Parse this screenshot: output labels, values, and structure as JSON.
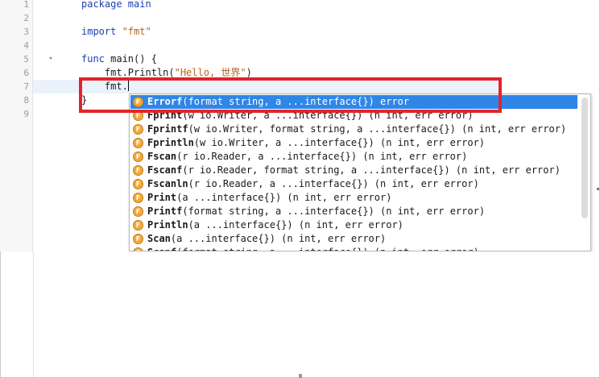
{
  "editor": {
    "lines": [
      {
        "num": "1",
        "segments": [
          {
            "t": "package main",
            "c": "kw"
          }
        ]
      },
      {
        "num": "2",
        "segments": []
      },
      {
        "num": "3",
        "segments": [
          {
            "t": "import ",
            "c": "kw"
          },
          {
            "t": "\"fmt\"",
            "c": "str"
          }
        ]
      },
      {
        "num": "4",
        "segments": []
      },
      {
        "num": "5",
        "segments": [
          {
            "t": "func ",
            "c": "kw"
          },
          {
            "t": "main() {",
            "c": "plain"
          }
        ],
        "fold": "▾"
      },
      {
        "num": "6",
        "segments": [
          {
            "t": "    fmt.Println(",
            "c": "plain"
          },
          {
            "t": "\"Hello, 世界\"",
            "c": "str"
          },
          {
            "t": ")",
            "c": "plain"
          }
        ]
      },
      {
        "num": "7",
        "segments": [
          {
            "t": "    fmt.",
            "c": "plain"
          }
        ],
        "current": true,
        "caret": true
      },
      {
        "num": "8",
        "segments": [
          {
            "t": "}",
            "c": "plain"
          }
        ]
      },
      {
        "num": "9",
        "segments": []
      }
    ]
  },
  "autocomplete": {
    "icon_letter": "F",
    "items": [
      {
        "name": "Errorf",
        "rest": "(format string, a ...interface{}) error",
        "selected": true
      },
      {
        "name": "Fprint",
        "rest": "(w io.Writer, a ...interface{}) (n int, err error)"
      },
      {
        "name": "Fprintf",
        "rest": "(w io.Writer, format string, a ...interface{}) (n int, err error)"
      },
      {
        "name": "Fprintln",
        "rest": "(w io.Writer, a ...interface{}) (n int, err error)"
      },
      {
        "name": "Fscan",
        "rest": "(r io.Reader, a ...interface{}) (n int, err error)"
      },
      {
        "name": "Fscanf",
        "rest": "(r io.Reader, format string, a ...interface{}) (n int, err error)"
      },
      {
        "name": "Fscanln",
        "rest": "(r io.Reader, a ...interface{}) (n int, err error)"
      },
      {
        "name": "Print",
        "rest": "(a ...interface{}) (n int, err error)"
      },
      {
        "name": "Printf",
        "rest": "(format string, a ...interface{}) (n int, err error)"
      },
      {
        "name": "Println",
        "rest": "(a ...interface{}) (n int, err error)"
      },
      {
        "name": "Scan",
        "rest": "(a ...interface{}) (n int, err error)"
      },
      {
        "name": "Scanf",
        "rest": "(format string, a ...interface{}) (n int, err error)"
      }
    ]
  },
  "colors": {
    "keyword": "#1f3fb0",
    "string": "#b5651d",
    "selection": "#2f86e6",
    "annotation_box": "#e3232b",
    "function_icon": "#f2a93b"
  }
}
